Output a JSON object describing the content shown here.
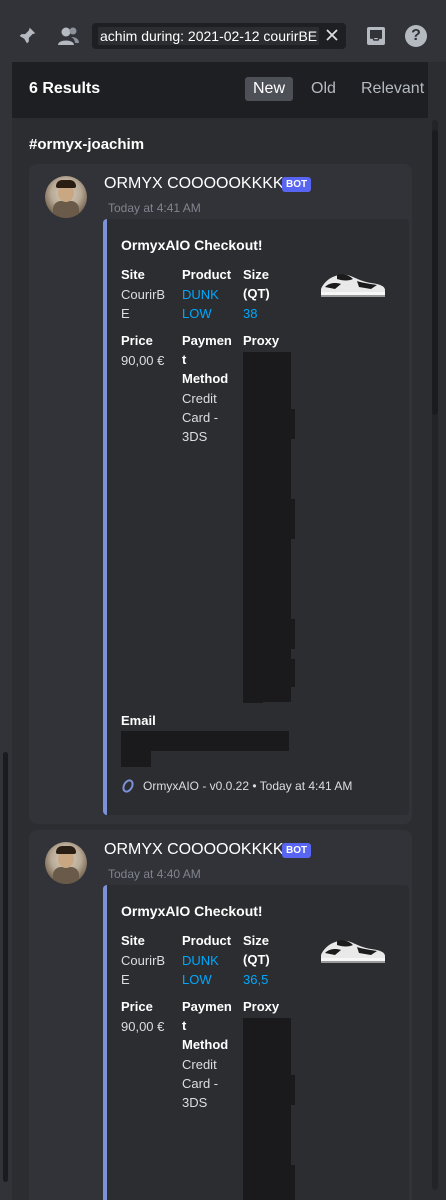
{
  "toolbar": {
    "pin_icon": "pin-icon",
    "members_icon": "members-icon",
    "search_query": "achim   during: 2021-02-12  courirBE",
    "clear_icon": "close-icon",
    "inbox_icon": "inbox-icon",
    "help_icon": "help-icon",
    "help_glyph": "?"
  },
  "results": {
    "count_label": "6 Results",
    "sort_tabs": [
      "New",
      "Old",
      "Relevant"
    ],
    "active_sort": "New",
    "channel": "#ormyx-joachim"
  },
  "messages": [
    {
      "author": "ORMYX COOOOOKKKK",
      "badge": "BOT",
      "time": "Today at 4:41 AM",
      "embed": {
        "title": "OrmyxAIO Checkout!",
        "site_label": "Site",
        "site_value_1": "CourirB",
        "site_value_2": "E",
        "product_label": "Product",
        "product_value_1": "DUNK",
        "product_value_2": "LOW",
        "size_label_1": "Size",
        "size_label_2": "(QT)",
        "size_value": "38",
        "price_label": "Price",
        "price_value": "90,00 €",
        "payment_label_1": "Paymen",
        "payment_label_2": "t",
        "payment_label_3": "Method",
        "payment_value_1": "Credit",
        "payment_value_2": "Card -",
        "payment_value_3": "3DS",
        "proxy_label": "Proxy",
        "email_label": "Email",
        "footer": "OrmyxAIO - v0.0.22 • Today at 4:41 AM"
      }
    },
    {
      "author": "ORMYX COOOOOKKKK",
      "badge": "BOT",
      "time": "Today at 4:40 AM",
      "embed": {
        "title": "OrmyxAIO Checkout!",
        "site_label": "Site",
        "site_value_1": "CourirB",
        "site_value_2": "E",
        "product_label": "Product",
        "product_value_1": "DUNK",
        "product_value_2": "LOW",
        "size_label_1": "Size",
        "size_label_2": "(QT)",
        "size_value": "36,5",
        "price_label": "Price",
        "price_value": "90,00 €",
        "payment_label_1": "Paymen",
        "payment_label_2": "t",
        "payment_label_3": "Method",
        "payment_value_1": "Credit",
        "payment_value_2": "Card -",
        "payment_value_3": "3DS",
        "proxy_label": "Proxy"
      }
    }
  ],
  "colors": {
    "background": "#2b2d31",
    "card": "#313338",
    "embed_border": "#7d92d6",
    "link": "#00a8fc",
    "bot_badge": "#5865f2"
  }
}
